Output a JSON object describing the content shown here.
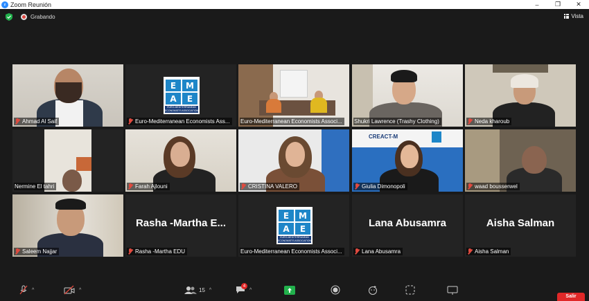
{
  "window": {
    "title": "Zoom Reunión",
    "controls": [
      "–",
      "❐",
      "✕"
    ]
  },
  "header": {
    "recording_label": "Grabando",
    "view_label": "Vista"
  },
  "participants": [
    {
      "name": "Ahmad Al Saif",
      "muted": true,
      "video": true
    },
    {
      "name": "Euro-Mediterranean Economists Ass...",
      "muted": true,
      "video": false,
      "logo": true
    },
    {
      "name": "Euro-Mediterranean Economists Associ...",
      "muted": false,
      "video": true,
      "active": true
    },
    {
      "name": "Shukri Lawrence (Trashy Clothing)",
      "muted": false,
      "video": true
    },
    {
      "name": "Neda kharoub",
      "muted": true,
      "video": true
    },
    {
      "name": "Nermine El tahri",
      "muted": false,
      "video": true
    },
    {
      "name": "Farah Ajlouni",
      "muted": true,
      "video": true
    },
    {
      "name": "CRISTINA VALERO",
      "muted": true,
      "video": true
    },
    {
      "name": "Giulia Dimonopoli",
      "muted": true,
      "video": true,
      "banner": "CREACT-M"
    },
    {
      "name": "waad bousserwel",
      "muted": true,
      "video": true
    },
    {
      "name": "Saleem Najjar",
      "muted": true,
      "video": true
    },
    {
      "name": "Rasha -Martha EDU",
      "display": "Rasha -Martha E...",
      "muted": true,
      "video": false
    },
    {
      "name": "Euro-Mediterranean Economists Associ...",
      "muted": false,
      "video": false,
      "logo": true
    },
    {
      "name": "Lana Abusamra",
      "display": "Lana Abusamra",
      "muted": true,
      "video": false
    },
    {
      "name": "Aisha Salman",
      "display": "Aisha Salman",
      "muted": true,
      "video": false
    }
  ],
  "logo": {
    "letters": [
      "E",
      "M",
      "A",
      "E"
    ],
    "caption": "EURO-MEDITERRANEAN ECONOMISTS ASSOCIATION"
  },
  "toolbar": {
    "participants_count": "15",
    "chat_badge": "4",
    "leave_label": "Salir"
  },
  "colors": {
    "active_border": "#c5d62c",
    "muted_icon": "#e04a3f",
    "leave": "#e02828",
    "zoom_blue": "#2d8cff"
  }
}
